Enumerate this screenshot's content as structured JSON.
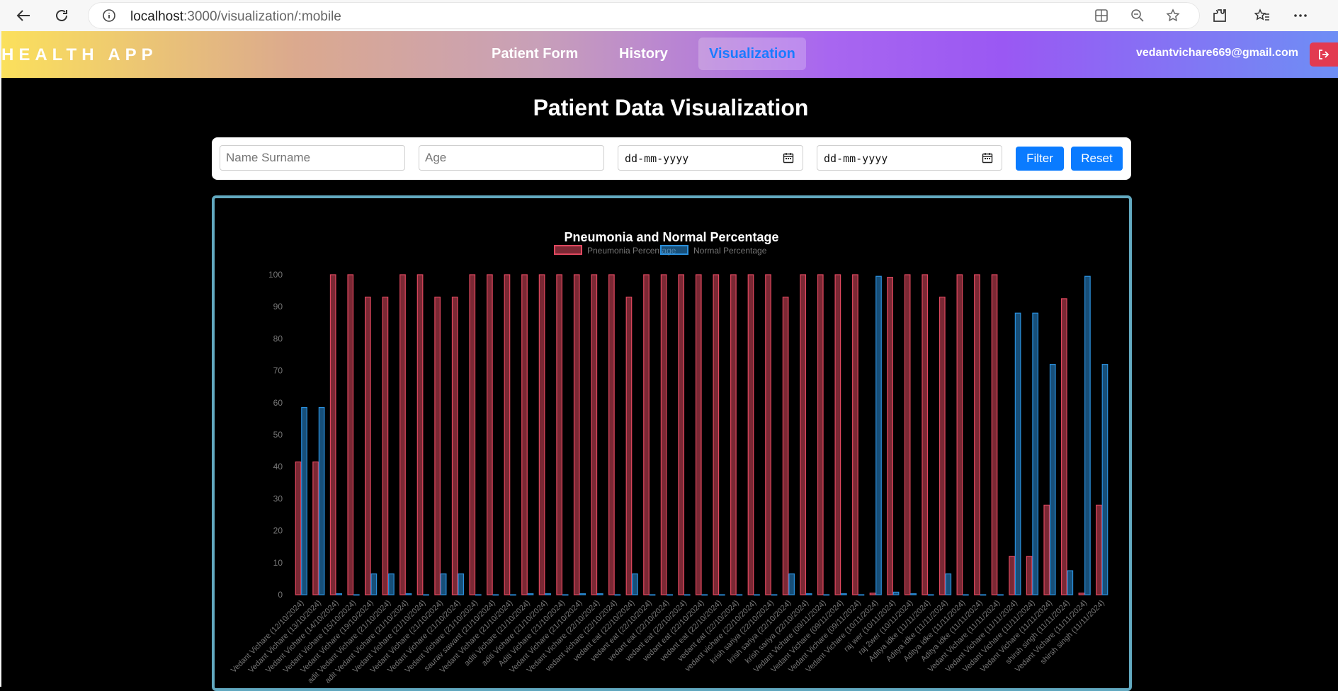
{
  "browser": {
    "url_host": "localhost",
    "url_rest": ":3000/visualization/:mobile"
  },
  "header": {
    "brand": "HEALTH APP",
    "nav": [
      {
        "label": "Patient Form",
        "active": false
      },
      {
        "label": "History",
        "active": false
      },
      {
        "label": "Visualization",
        "active": true
      }
    ],
    "email": "vedantvichare669@gmail.com"
  },
  "page": {
    "title": "Patient Data Visualization"
  },
  "filters": {
    "name_placeholder": "Name Surname",
    "age_placeholder": "Age",
    "date_from": "dd-mm-yyyy",
    "date_to": "dd-mm-yyyy",
    "filter_label": "Filter",
    "reset_label": "Reset"
  },
  "colors": {
    "pneumonia": "#e0485f",
    "normal": "#2a8fdc",
    "panel_border": "#62a9c0",
    "button": "#0a7bff",
    "logout": "#e23a50"
  },
  "chart_data": {
    "type": "bar",
    "title": "Pneumonia and Normal Percentage",
    "legend_position": "top",
    "ylim": [
      0,
      100
    ],
    "yticks": [
      0,
      10,
      20,
      30,
      40,
      50,
      60,
      70,
      80,
      90,
      100
    ],
    "grid": false,
    "categories": [
      "Vedant Vichare (12/10/2024)",
      "Vedant Vichare (13/10/2024)",
      "Vedant Vichare (14/10/2024)",
      "Vedant Vichare (15/10/2024)",
      "Vedant Vichare (19/10/2024)",
      "adit Vedant Vichare (21/10/2024)",
      "adit Vedant Vichare (21/10/2024)",
      "Vedant Vichare (21/10/2024)",
      "Vedant Vichare (21/10/2024)",
      "Vedant Vichare (21/10/2024)",
      "Vedant Vichare (21/10/2024)",
      "saurav sawant (21/10/2024)",
      "Vedant Vichare (21/10/2024)",
      "aditi Vichare (21/10/2024)",
      "aditi Vichare (21/10/2024)",
      "Aditi Vichare (21/10/2024)",
      "Vedant Vichare (21/10/2024)",
      "Vedant Vichare (22/10/2024)",
      "vedant vichare (22/10/2024)",
      "vedant eat (22/10/2024)",
      "vedant eat (22/10/2024)",
      "vedant eat (22/10/2024)",
      "vedant eat (22/10/2024)",
      "vedant eat (22/10/2024)",
      "vedant eat (22/10/2024)",
      "vedant eat (22/10/2024)",
      "vedant vichare (22/10/2024)",
      "krish sariya (22/10/2024)",
      "krish sariya (22/10/2024)",
      "krish sariya (22/10/2024)",
      "Vedant Vichare (09/11/2024)",
      "Vedant Vichare (09/11/2024)",
      "Vedant Vichare (09/11/2024)",
      "Vedant Vichare (10/11/2024)",
      "raj wer (10/11/2024)",
      "raj 2wer (10/11/2024)",
      "Aditya idke (11/11/2024)",
      "Aditya idke (11/11/2024)",
      "Aditya idke (11/11/2024)",
      "Aditya idke (11/11/2024)",
      "Vedant Vichare (11/11/2024)",
      "Vedant Vichare (11/11/2024)",
      "Vedant Vichare (11/11/2024)",
      "Vedant Vichare (11/11/2024)",
      "shirsh singh (11/11/2024)",
      "Vedant Vichare (11/11/2024)",
      "shirsh singh (11/11/2024)"
    ],
    "series": [
      {
        "name": "Pneumonia Percentage",
        "values": [
          41.5,
          41.5,
          100,
          100,
          93,
          93,
          100,
          100,
          93,
          93,
          100,
          100,
          100,
          100,
          100,
          100,
          100,
          100,
          100,
          93,
          100,
          100,
          100,
          100,
          100,
          100,
          100,
          100,
          93,
          100,
          100,
          100,
          100,
          0.5,
          99.2,
          100,
          100,
          93,
          100,
          100,
          100,
          12,
          12,
          28,
          92.5,
          0.5,
          28
        ]
      },
      {
        "name": "Normal Percentage",
        "values": [
          58.5,
          58.5,
          0.3,
          0,
          6.5,
          6.5,
          0.3,
          0,
          6.5,
          6.5,
          0,
          0,
          0,
          0.3,
          0.3,
          0,
          0.3,
          0.3,
          0,
          6.5,
          0,
          0,
          0,
          0,
          0,
          0,
          0,
          0,
          6.5,
          0.3,
          0,
          0.3,
          0,
          99.5,
          0.8,
          0.3,
          0,
          6.5,
          0,
          0,
          0,
          88,
          88,
          72,
          7.5,
          99.5,
          72
        ]
      }
    ]
  }
}
